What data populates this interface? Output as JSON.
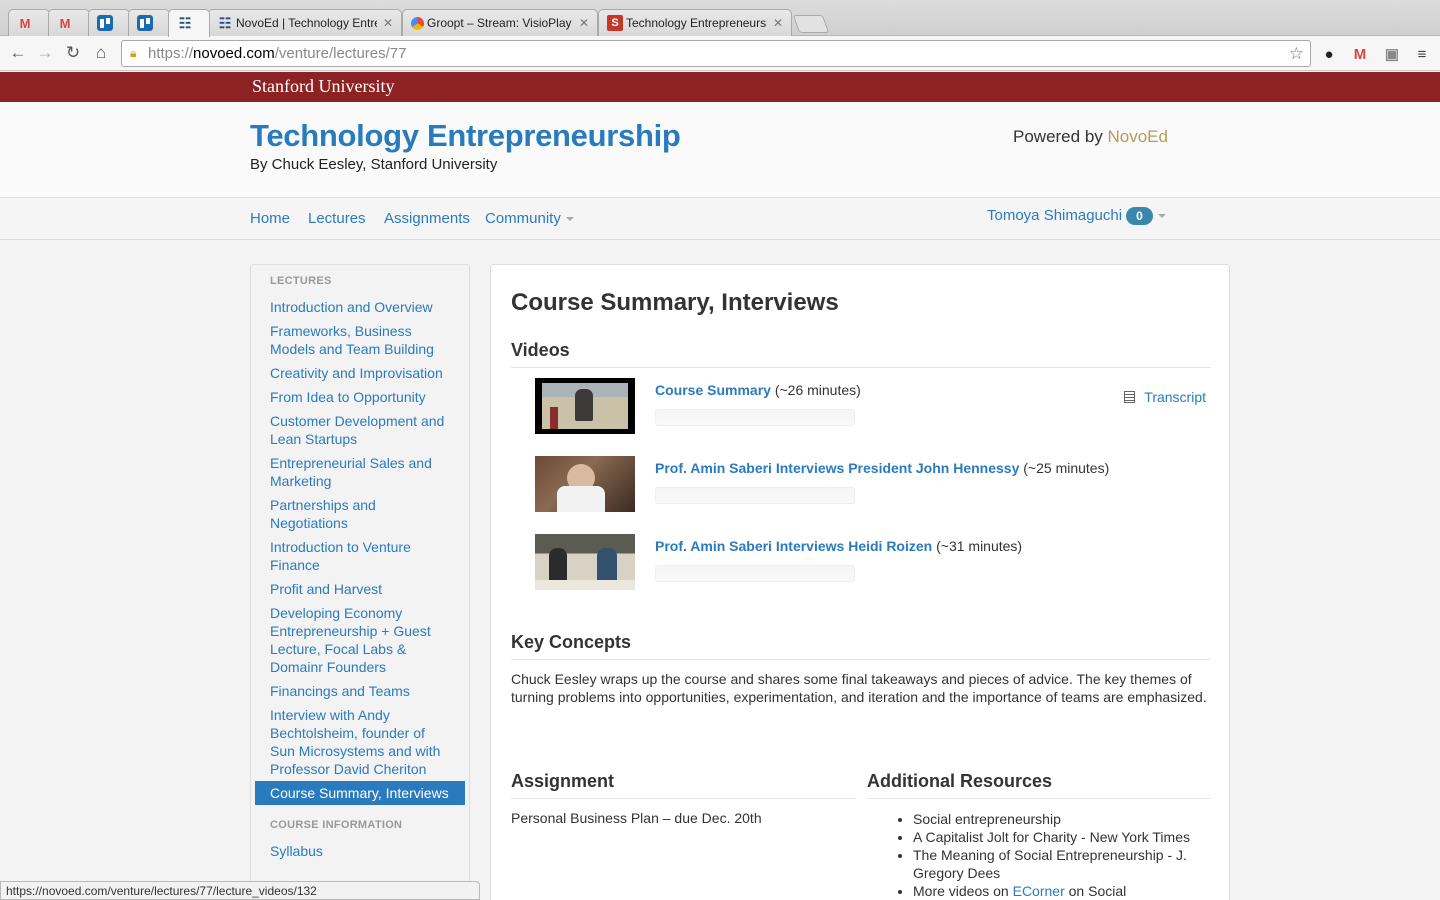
{
  "browser": {
    "tabs": [
      {
        "title": "",
        "icon": "gmail-icon",
        "active": false
      },
      {
        "title": "",
        "icon": "gmail-icon",
        "active": false
      },
      {
        "title": "",
        "icon": "trello-icon",
        "active": false
      },
      {
        "title": "",
        "icon": "trello-icon",
        "active": false
      },
      {
        "title": "",
        "icon": "novoed-icon",
        "active": true
      },
      {
        "title": "NovoEd | Technology Entre",
        "icon": "novoed-icon",
        "active": false
      },
      {
        "title": "Groopt – Stream: VisioPlay",
        "icon": "groopt-icon",
        "active": false
      },
      {
        "title": "Technology Entrepreneursh",
        "icon": "stanford-icon",
        "active": false
      }
    ],
    "url_scheme": "https://",
    "url_domain": "novoed.com",
    "url_path": "/venture/lectures/77",
    "status_url": "https://novoed.com/venture/lectures/77/lecture_videos/132"
  },
  "university": "Stanford University",
  "header": {
    "course_title": "Technology Entrepreneurship",
    "byline": "By Chuck Eesley, Stanford University",
    "powered_prefix": "Powered by ",
    "powered_brand": "NovoEd",
    "brand_color": "#b59b57"
  },
  "nav": {
    "home": "Home",
    "lectures": "Lectures",
    "assignments": "Assignments",
    "community": "Community",
    "user": "Tomoya Shimaguchi",
    "notifications": "0"
  },
  "sidebar": {
    "lectures_heading": "LECTURES",
    "items": [
      {
        "label": "Introduction and Overview"
      },
      {
        "label": "Frameworks, Business Models and Team Building"
      },
      {
        "label": "Creativity and Improvisation"
      },
      {
        "label": "From Idea to Opportunity"
      },
      {
        "label": "Customer Development and Lean Startups"
      },
      {
        "label": "Entrepreneurial Sales and Marketing"
      },
      {
        "label": "Partnerships and Negotiations"
      },
      {
        "label": "Introduction to Venture Finance"
      },
      {
        "label": "Profit and Harvest"
      },
      {
        "label": "Developing Economy Entrepreneurship + Guest Lecture, Focal Labs & Domainr Founders"
      },
      {
        "label": "Financings and Teams"
      },
      {
        "label": "Interview with Andy Bechtolsheim, founder of Sun Microsystems and with Professor David Cheriton"
      },
      {
        "label": "Course Summary, Interviews"
      }
    ],
    "active_index": 12,
    "info_heading": "COURSE INFORMATION",
    "syllabus": "Syllabus"
  },
  "main": {
    "title": "Course Summary, Interviews",
    "videos_heading": "Videos",
    "transcript": "Transcript",
    "videos": [
      {
        "title": "Course Summary",
        "duration": " (~26 minutes)"
      },
      {
        "title": "Prof. Amin Saberi Interviews President John Hennessy",
        "duration": " (~25 minutes)"
      },
      {
        "title": "Prof. Amin Saberi Interviews Heidi Roizen",
        "duration": " (~31 minutes)"
      }
    ],
    "key_concepts_heading": "Key Concepts",
    "key_concepts_text": "Chuck Eesley wraps up the course and shares some final takeaways and pieces of advice. The key themes of turning problems into opportunities, experimentation, and iteration and the importance of teams are emphasized.",
    "assignment_heading": "Assignment",
    "assignment_text": "Personal Business Plan – due Dec. 20th",
    "resources_heading": "Additional Resources",
    "resources": [
      "Social entrepreneurship",
      "A Capitalist Jolt for Charity - New York Times",
      "The Meaning of Social Entrepreneurship - J. Gregory Dees"
    ],
    "resource_more_prefix": "More videos on ",
    "resource_more_link": "ECorner",
    "resource_more_suffix": " on Social"
  },
  "colors": {
    "stanford_red": "#8c2222",
    "link_blue": "#2a7bbd",
    "badge_blue": "#3a87ad"
  }
}
